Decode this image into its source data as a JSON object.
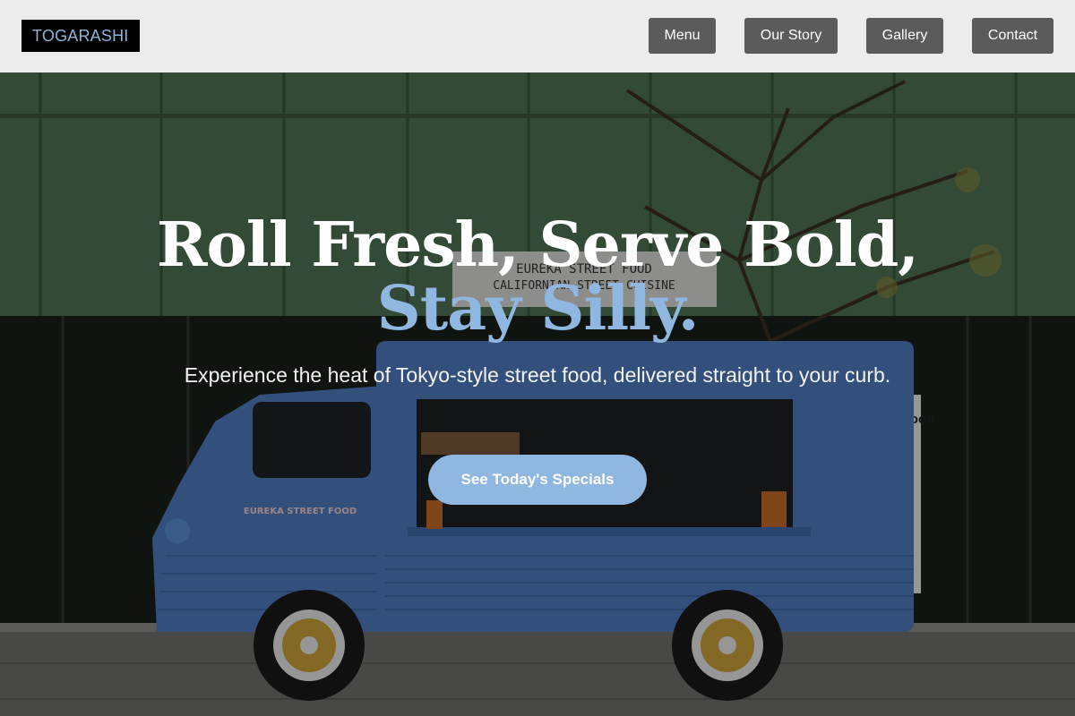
{
  "brand": {
    "logo_text": "TOGARASHI"
  },
  "nav": {
    "items": [
      {
        "label": "Menu"
      },
      {
        "label": "Our Story"
      },
      {
        "label": "Gallery"
      },
      {
        "label": "Contact"
      }
    ]
  },
  "hero": {
    "headline": "Roll Fresh, Serve Bold,",
    "headline_accent": "Stay Silly.",
    "subtext": "Experience the heat of Tokyo-style street food, delivered straight to your curb.",
    "cta_label": "See Today's Specials",
    "background": {
      "sign_line1": "EUREKA STREET FOOD",
      "sign_line2": "CALIFORNIAN STREET CUISINE",
      "truck_side_text": "EUREKA STREET FOOD",
      "board_text": "EUREKA STREET FOOD"
    }
  },
  "colors": {
    "accent": "#8fb7df",
    "header_bg": "#ececec",
    "nav_button_bg": "#5b5b5b",
    "truck_blue": "#4f7cc0"
  }
}
